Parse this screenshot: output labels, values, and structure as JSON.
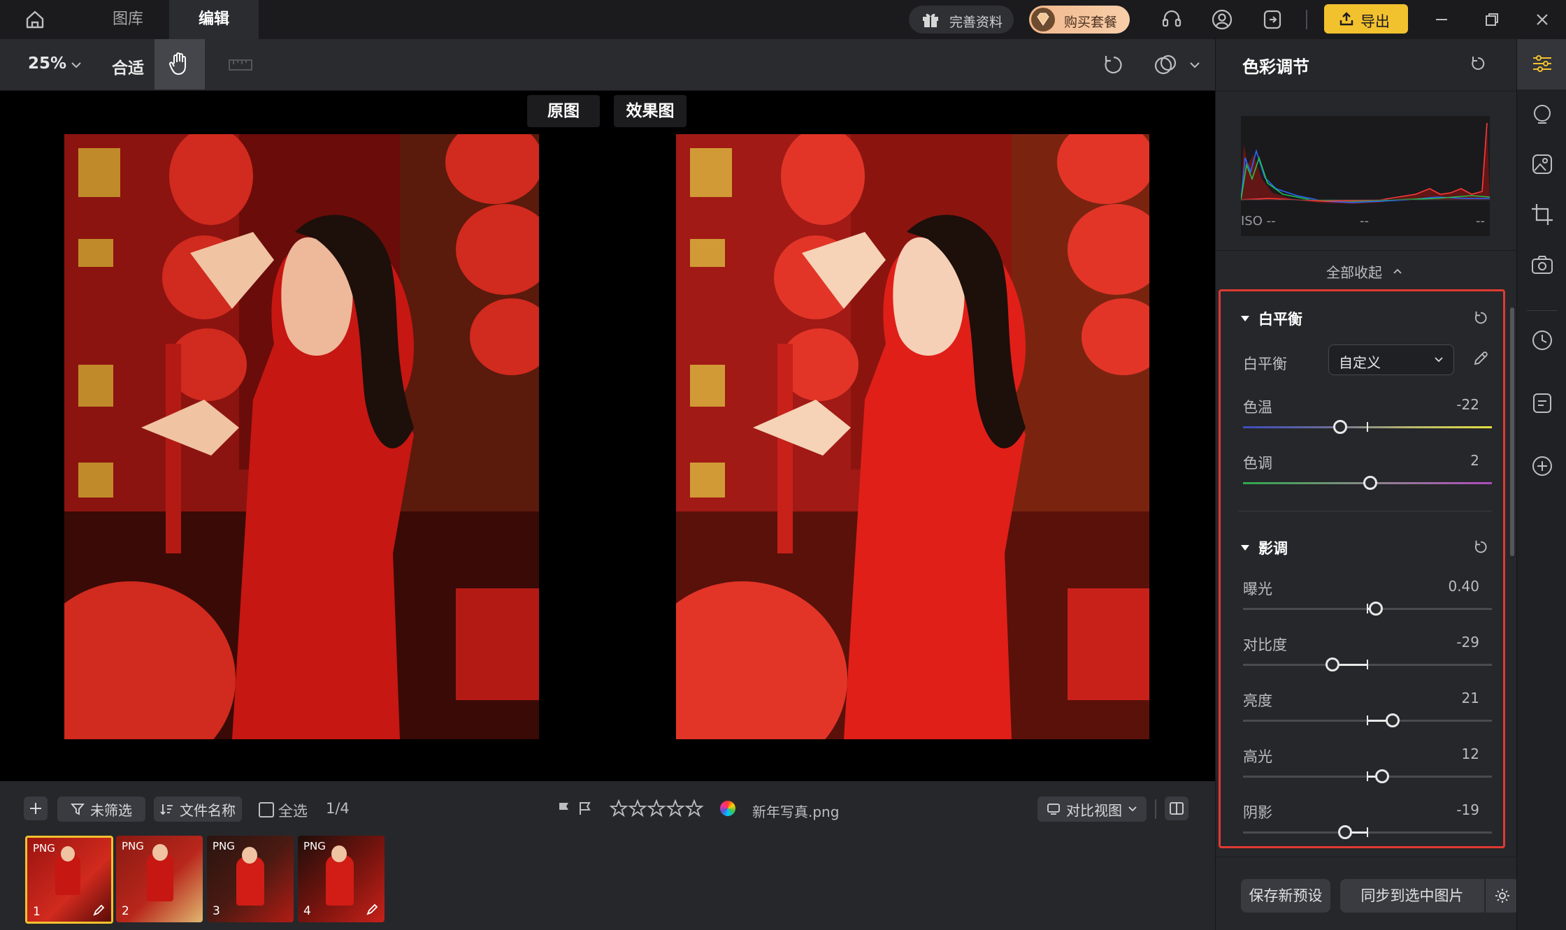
{
  "nav": {
    "home_label": "",
    "tabs": [
      "图库",
      "编辑"
    ]
  },
  "topbar": {
    "complete_profile": "完善资料",
    "buy_package": "购买套餐",
    "export": "导出"
  },
  "toolbar": {
    "zoom": "25%",
    "fit": "合适"
  },
  "compare_labels": {
    "original": "原图",
    "effect": "效果图"
  },
  "panel": {
    "title": "色彩调节",
    "histogram": {
      "iso": "ISO --",
      "mid": "--",
      "right": "--"
    },
    "collapse_all": "全部收起",
    "white_balance": {
      "section": "白平衡",
      "label": "白平衡",
      "mode": "自定义",
      "temp_label": "色温",
      "temp_value": "-22",
      "temp_pct": 0.39,
      "tint_label": "色调",
      "tint_value": "2",
      "tint_pct": 0.51
    },
    "tone": {
      "section": "影调",
      "sliders": [
        {
          "label": "曝光",
          "value": "0.40",
          "pct": 0.534
        },
        {
          "label": "对比度",
          "value": "-29",
          "pct": 0.36
        },
        {
          "label": "亮度",
          "value": "21",
          "pct": 0.6
        },
        {
          "label": "高光",
          "value": "12",
          "pct": 0.56
        },
        {
          "label": "阴影",
          "value": "-19",
          "pct": 0.41
        }
      ]
    },
    "save_preset": "保存新预设",
    "sync": "同步到选中图片"
  },
  "bottom": {
    "filter": "未筛选",
    "sort": "文件名称",
    "select_all": "全选",
    "count": "1/4",
    "filename": "新年写真.png",
    "view_mode": "对比视图",
    "thumbs": [
      {
        "badge": "PNG",
        "index": "1"
      },
      {
        "badge": "PNG",
        "index": "2"
      },
      {
        "badge": "PNG",
        "index": "3"
      },
      {
        "badge": "PNG",
        "index": "4"
      }
    ]
  },
  "colors": {
    "accent": "#f2c12e",
    "highlight_border": "#e03a32",
    "bg": "#1e1f22"
  }
}
